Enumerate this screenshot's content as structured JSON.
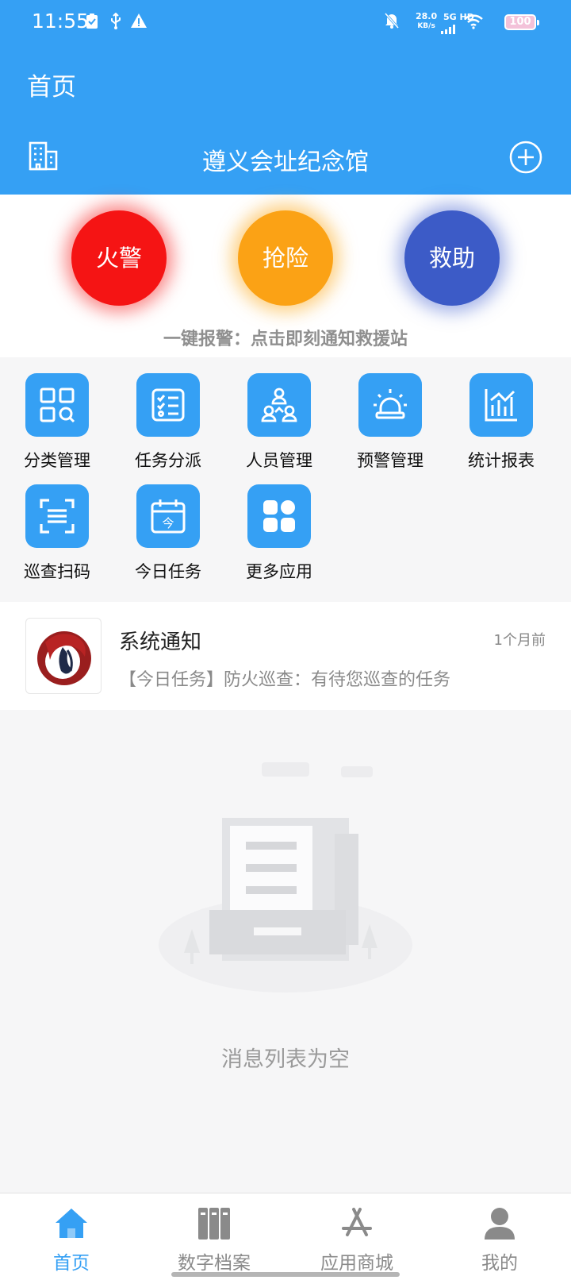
{
  "status_bar": {
    "time": "11:55",
    "net_speed_value": "28.0",
    "net_speed_unit": "KB/s",
    "network_label": "5G HD",
    "battery": "100"
  },
  "header": {
    "title": "首页",
    "org_name": "遵义会址纪念馆"
  },
  "emergency": {
    "buttons": [
      {
        "label": "火警",
        "color": "#f51414"
      },
      {
        "label": "抢险",
        "color": "#fba215"
      },
      {
        "label": "救助",
        "color": "#3c5bc7"
      }
    ],
    "hint": "一键报警：点击即刻通知救援站"
  },
  "apps": [
    {
      "label": "分类管理",
      "icon": "category-icon"
    },
    {
      "label": "任务分派",
      "icon": "task-list-icon"
    },
    {
      "label": "人员管理",
      "icon": "people-icon"
    },
    {
      "label": "预警管理",
      "icon": "alarm-light-icon"
    },
    {
      "label": "统计报表",
      "icon": "chart-icon"
    },
    {
      "label": "巡查扫码",
      "icon": "scan-icon"
    },
    {
      "label": "今日任务",
      "icon": "calendar-today-icon"
    },
    {
      "label": "更多应用",
      "icon": "more-apps-icon"
    }
  ],
  "notice": {
    "title": "系统通知",
    "time": "1个月前",
    "body": "【今日任务】防火巡查：有待您巡查的任务"
  },
  "empty_state": {
    "text": "消息列表为空"
  },
  "bottom_nav": [
    {
      "label": "首页",
      "icon": "home-icon",
      "active": true
    },
    {
      "label": "数字档案",
      "icon": "archive-icon",
      "active": false
    },
    {
      "label": "应用商城",
      "icon": "app-store-icon",
      "active": false
    },
    {
      "label": "我的",
      "icon": "user-icon",
      "active": false
    }
  ],
  "colors": {
    "primary": "#35a0f4",
    "background": "#f6f6f7"
  }
}
